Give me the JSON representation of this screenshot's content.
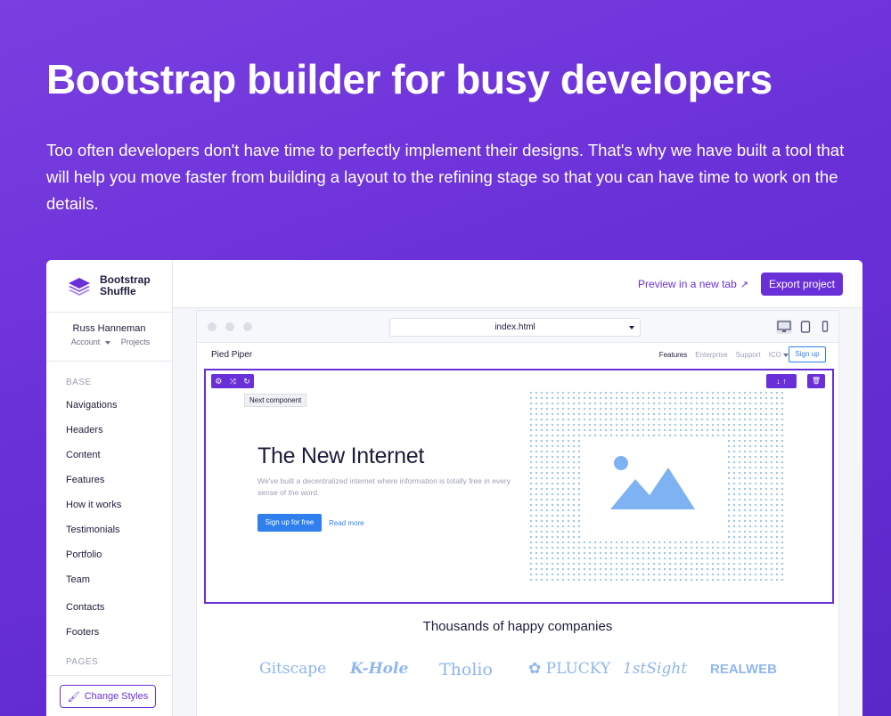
{
  "hero": {
    "title": "Bootstrap builder for busy developers",
    "description": "Too often developers don't have time to perfectly implement their designs. That's why we have built a tool that will help you move faster from building a layout to the refining stage so that you can have time to work on the details."
  },
  "sidebar": {
    "brand": "Bootstrap Shuffle",
    "user": {
      "name": "Russ Hanneman",
      "account": "Account",
      "projects": "Projects"
    },
    "section_base": "BASE",
    "items": [
      "Navigations",
      "Headers",
      "Content",
      "Features",
      "How it works",
      "Testimonials",
      "Portfolio",
      "Team",
      "Contacts",
      "Footers"
    ],
    "section_pages": "PAGES",
    "change_styles": "Change Styles"
  },
  "topbar": {
    "preview": "Preview in a new tab",
    "export": "Export project"
  },
  "browser": {
    "url": "index.html"
  },
  "preview": {
    "brand": "Pied Piper",
    "nav": [
      "Features",
      "Enterprise",
      "Support",
      "ICO"
    ],
    "signup": "Sign up",
    "tooltip": "Next component",
    "heading": "The New Internet",
    "text": "We've built a decentralized internet where information is totally free in every sense of the word.",
    "cta": "Sign up for free",
    "more": "Read more",
    "companies_title": "Thousands of happy companies",
    "logos": [
      "Gitscape",
      "K-Hole",
      "Tholio",
      "PLUCKY",
      "1stSight",
      "REALWEB"
    ]
  },
  "colors": {
    "accent": "#6a30d8",
    "link_blue": "#2f80ed",
    "image_blue": "#7fb2f3"
  }
}
